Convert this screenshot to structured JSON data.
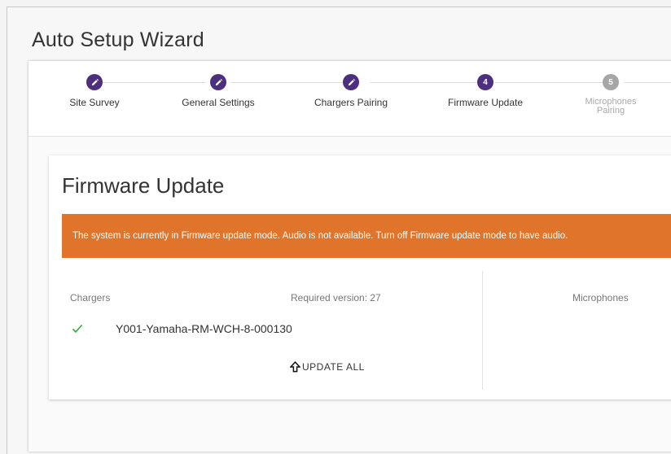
{
  "app": {
    "title": "Auto Setup Wizard"
  },
  "steps": [
    {
      "label": "Site Survey",
      "marker": "",
      "icon": "pencil-icon",
      "state": "done"
    },
    {
      "label": "General Settings",
      "marker": "",
      "icon": "pencil-icon",
      "state": "done"
    },
    {
      "label": "Chargers Pairing",
      "marker": "",
      "icon": "pencil-icon",
      "state": "done"
    },
    {
      "label": "Firmware Update",
      "marker": "4",
      "icon": "",
      "state": "active"
    },
    {
      "label": "Microphones Pairing",
      "marker": "5",
      "icon": "",
      "state": "disabled"
    }
  ],
  "firmware": {
    "title": "Firmware Update",
    "banner": "The system is currently in Firmware update mode. Audio is not available. Turn off Firmware update mode to have audio.",
    "chargers_heading": "Chargers",
    "required_version": "Required version: 27",
    "microphones_heading": "Microphones",
    "chargers": [
      {
        "name": "Y001-Yamaha-RM-WCH-8-000130",
        "status": "check-icon"
      }
    ],
    "update_all_label": "UPDATE ALL"
  },
  "colors": {
    "accent": "#4c2f7f",
    "disabled": "#a6a6a6",
    "banner": "#e0742b",
    "check": "#2eab3a"
  }
}
